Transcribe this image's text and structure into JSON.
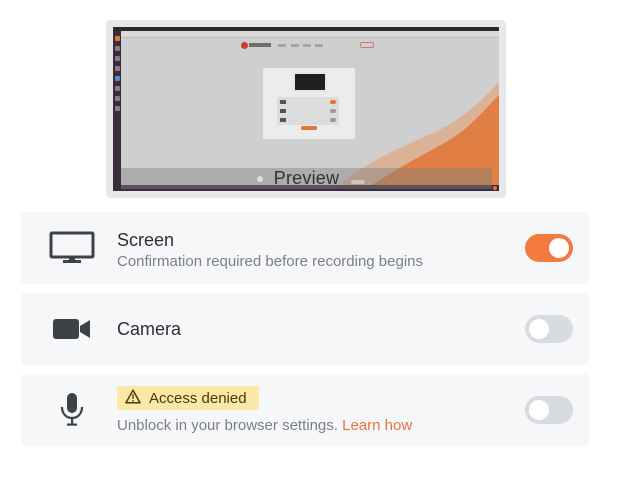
{
  "preview": {
    "label": "Preview"
  },
  "sources": {
    "screen": {
      "title": "Screen",
      "subtitle": "Confirmation required before recording begins",
      "enabled": true,
      "icon": "monitor-icon"
    },
    "camera": {
      "title": "Camera",
      "enabled": false,
      "icon": "video-camera-icon"
    },
    "microphone": {
      "badge": "Access denied",
      "badge_icon": "warning-icon",
      "subtitle": "Unblock in your browser settings.",
      "link": "Learn how",
      "enabled": false,
      "icon": "microphone-icon"
    }
  },
  "colors": {
    "accent": "#f37b3f",
    "link": "#e8733a",
    "warning_bg": "#fbe8a6",
    "toggle_off": "#d8dbdf",
    "row_bg": "#f6f7f8"
  }
}
